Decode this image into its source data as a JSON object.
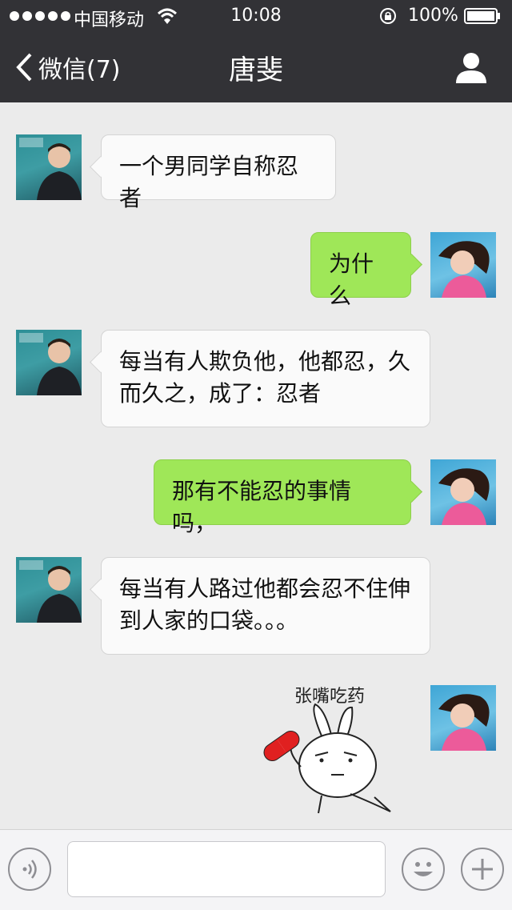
{
  "status_bar": {
    "carrier": "中国移动",
    "time": "10:08",
    "battery": "100%"
  },
  "nav": {
    "back_label": "微信(7)",
    "title": "唐斐"
  },
  "messages": [
    {
      "side": "in",
      "text": "一个男同学自称忍者"
    },
    {
      "side": "out",
      "text": "为什么"
    },
    {
      "side": "in",
      "text": "每当有人欺负他，他都忍，久而久之，成了：忍者"
    },
    {
      "side": "out",
      "text": "那有不能忍的事情吗，"
    },
    {
      "side": "in",
      "text": "每当有人路过他都会忍不住伸到人家的口袋。。。"
    },
    {
      "side": "out",
      "sticker": "rabbit-pill-sticker",
      "caption": "张嘴吃药"
    }
  ],
  "input_bar": {
    "voice_icon": "voice-icon",
    "emoji_icon": "emoji-icon",
    "add_icon": "plus-icon",
    "input_value": ""
  },
  "colors": {
    "header_bg": "#323236",
    "chat_bg": "#ebebeb",
    "bubble_out": "#9fe758",
    "bubble_in": "#fafafa"
  }
}
